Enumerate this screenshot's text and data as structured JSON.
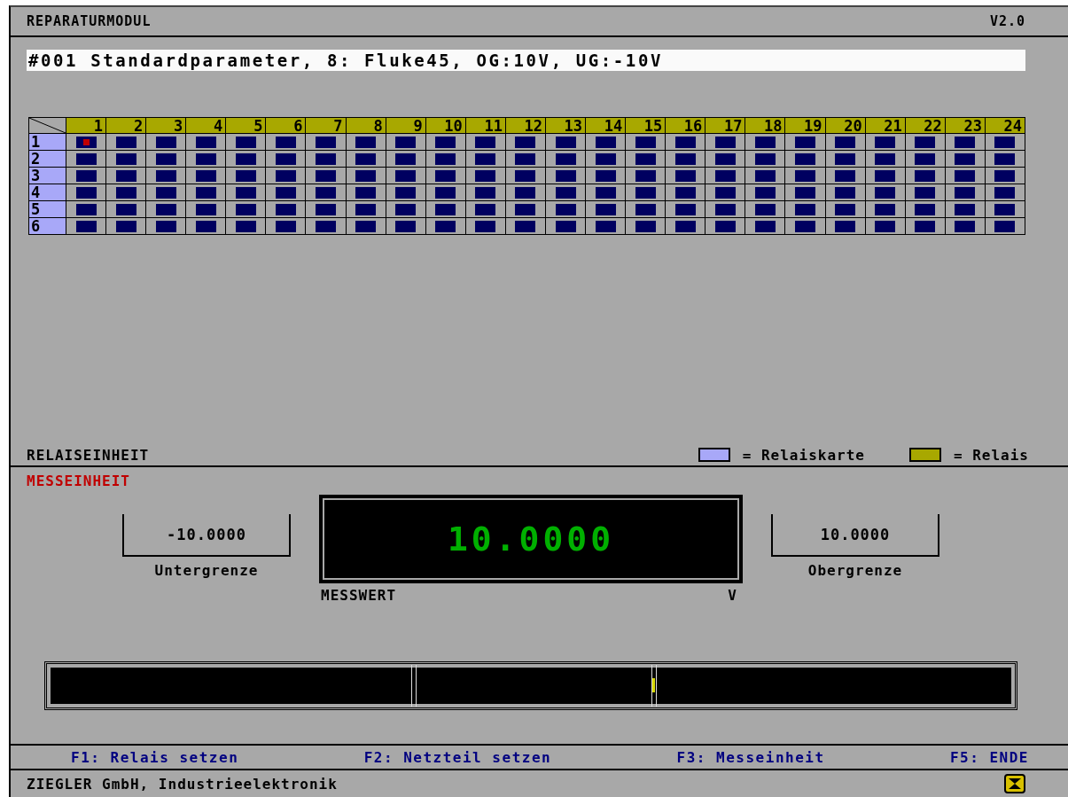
{
  "window": {
    "title": "REPARATURMODUL",
    "version": "V2.0"
  },
  "parameter_line": "#001 Standardparameter, 8: Fluke45, OG:10V, UG:-10V",
  "relay_grid": {
    "columns": [
      "1",
      "2",
      "3",
      "4",
      "5",
      "6",
      "7",
      "8",
      "9",
      "10",
      "11",
      "12",
      "13",
      "14",
      "15",
      "16",
      "17",
      "18",
      "19",
      "20",
      "21",
      "22",
      "23",
      "24"
    ],
    "rows": [
      {
        "label": "1",
        "relays": [
          {
            "on": true
          },
          {
            "on": false
          },
          {
            "on": false
          },
          {
            "on": false
          },
          {
            "on": false
          },
          {
            "on": false
          },
          {
            "on": false
          },
          {
            "on": false
          },
          {
            "on": false
          },
          {
            "on": false
          },
          {
            "on": false
          },
          {
            "on": false
          },
          {
            "on": false
          },
          {
            "on": false
          },
          {
            "on": false
          },
          {
            "on": false
          },
          {
            "on": false
          },
          {
            "on": false
          },
          {
            "on": false
          },
          {
            "on": false
          },
          {
            "on": false
          },
          {
            "on": false
          },
          {
            "on": false
          },
          {
            "on": false
          }
        ]
      },
      {
        "label": "2",
        "relays": [
          {
            "on": false
          },
          {
            "on": false
          },
          {
            "on": false
          },
          {
            "on": false
          },
          {
            "on": false
          },
          {
            "on": false
          },
          {
            "on": false
          },
          {
            "on": false
          },
          {
            "on": false
          },
          {
            "on": false
          },
          {
            "on": false
          },
          {
            "on": false
          },
          {
            "on": false
          },
          {
            "on": false
          },
          {
            "on": false
          },
          {
            "on": false
          },
          {
            "on": false
          },
          {
            "on": false
          },
          {
            "on": false
          },
          {
            "on": false
          },
          {
            "on": false
          },
          {
            "on": false
          },
          {
            "on": false
          },
          {
            "on": false
          }
        ]
      },
      {
        "label": "3",
        "relays": [
          {
            "on": false
          },
          {
            "on": false
          },
          {
            "on": false
          },
          {
            "on": false
          },
          {
            "on": false
          },
          {
            "on": false
          },
          {
            "on": false
          },
          {
            "on": false
          },
          {
            "on": false
          },
          {
            "on": false
          },
          {
            "on": false
          },
          {
            "on": false
          },
          {
            "on": false
          },
          {
            "on": false
          },
          {
            "on": false
          },
          {
            "on": false
          },
          {
            "on": false
          },
          {
            "on": false
          },
          {
            "on": false
          },
          {
            "on": false
          },
          {
            "on": false
          },
          {
            "on": false
          },
          {
            "on": false
          },
          {
            "on": false
          }
        ]
      },
      {
        "label": "4",
        "relays": [
          {
            "on": false
          },
          {
            "on": false
          },
          {
            "on": false
          },
          {
            "on": false
          },
          {
            "on": false
          },
          {
            "on": false
          },
          {
            "on": false
          },
          {
            "on": false
          },
          {
            "on": false
          },
          {
            "on": false
          },
          {
            "on": false
          },
          {
            "on": false
          },
          {
            "on": false
          },
          {
            "on": false
          },
          {
            "on": false
          },
          {
            "on": false
          },
          {
            "on": false
          },
          {
            "on": false
          },
          {
            "on": false
          },
          {
            "on": false
          },
          {
            "on": false
          },
          {
            "on": false
          },
          {
            "on": false
          },
          {
            "on": false
          }
        ]
      },
      {
        "label": "5",
        "relays": [
          {
            "on": false
          },
          {
            "on": false
          },
          {
            "on": false
          },
          {
            "on": false
          },
          {
            "on": false
          },
          {
            "on": false
          },
          {
            "on": false
          },
          {
            "on": false
          },
          {
            "on": false
          },
          {
            "on": false
          },
          {
            "on": false
          },
          {
            "on": false
          },
          {
            "on": false
          },
          {
            "on": false
          },
          {
            "on": false
          },
          {
            "on": false
          },
          {
            "on": false
          },
          {
            "on": false
          },
          {
            "on": false
          },
          {
            "on": false
          },
          {
            "on": false
          },
          {
            "on": false
          },
          {
            "on": false
          },
          {
            "on": false
          }
        ]
      },
      {
        "label": "6",
        "relays": [
          {
            "on": false
          },
          {
            "on": false
          },
          {
            "on": false
          },
          {
            "on": false
          },
          {
            "on": false
          },
          {
            "on": false
          },
          {
            "on": false
          },
          {
            "on": false
          },
          {
            "on": false
          },
          {
            "on": false
          },
          {
            "on": false
          },
          {
            "on": false
          },
          {
            "on": false
          },
          {
            "on": false
          },
          {
            "on": false
          },
          {
            "on": false
          },
          {
            "on": false
          },
          {
            "on": false
          },
          {
            "on": false
          },
          {
            "on": false
          },
          {
            "on": false
          },
          {
            "on": false
          },
          {
            "on": false
          },
          {
            "on": false
          }
        ]
      }
    ]
  },
  "relay_section": {
    "title": "RELAISEINHEIT",
    "legend": [
      {
        "label": "= Relaiskarte",
        "color": "#a8a8f8"
      },
      {
        "label": "= Relais",
        "color": "#a8a800"
      }
    ]
  },
  "measure_section": {
    "title": "MESSEINHEIT",
    "lower_limit": {
      "value": "-10.0000",
      "label": "Untergrenze"
    },
    "reading": {
      "value": "10.0000",
      "label": "MESSWERT",
      "unit": "V"
    },
    "upper_limit": {
      "value": "10.0000",
      "label": "Obergrenze"
    },
    "bar": {
      "level": 0.625
    }
  },
  "function_keys": [
    "F1: Relais setzen",
    "F2: Netzteil setzen",
    "F3: Messeinheit",
    "F5: ENDE"
  ],
  "status_bar": {
    "text": "ZIEGLER GmbH, Industrieelektronik"
  }
}
